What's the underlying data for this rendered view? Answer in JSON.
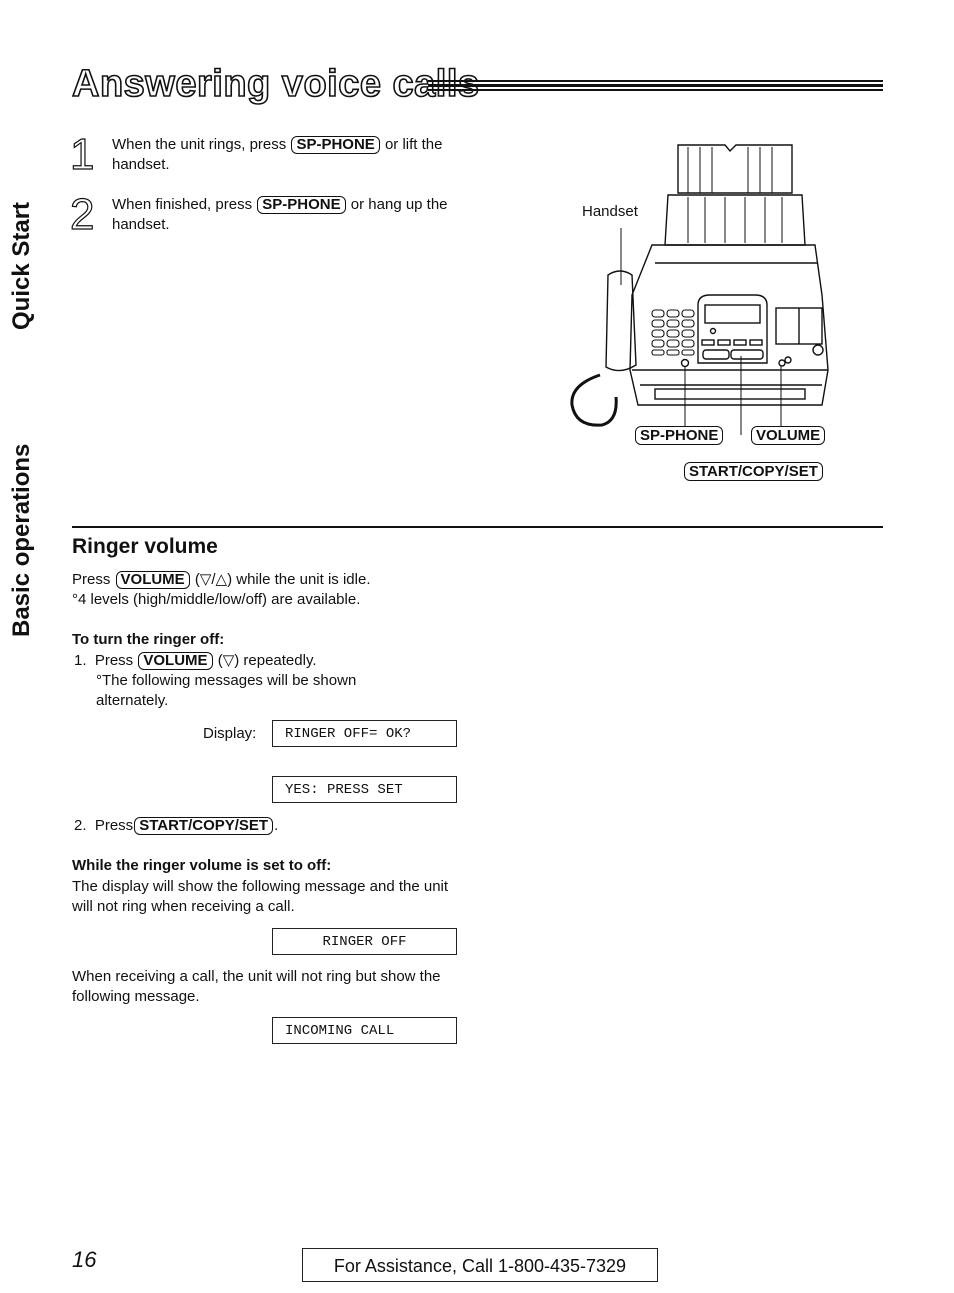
{
  "page": {
    "title": "Answering voice calls",
    "side_tabs": [
      "Quick Start",
      "Basic operations"
    ]
  },
  "steps": [
    {
      "number": "1",
      "pre": "When the unit rings, press",
      "key": "SP-PHONE",
      "post": "or lift the handset."
    },
    {
      "number": "2",
      "pre": "When finished, press",
      "key": "SP-PHONE",
      "post": "or hang up the handset."
    }
  ],
  "illustration": {
    "handset_label": "Handset",
    "callouts": [
      "SP-PHONE",
      "VOLUME",
      "START/COPY/SET"
    ]
  },
  "ringer": {
    "heading": "Ringer volume",
    "intro_pre": "Press",
    "intro_key": "VOLUME",
    "intro_post": "(▽/△) while the unit is idle.",
    "levels_note": "°4 levels (high/middle/low/off) are available.",
    "turn_off_heading": "To turn the ringer off:",
    "step1_pre": "1.  Press",
    "step1_key": "VOLUME",
    "step1_post": "(▽) repeatedly.",
    "step1_note": "°The following messages will be shown alternately.",
    "display_label": "Display:",
    "display_1": "RINGER OFF= OK?",
    "display_2": "YES: PRESS SET",
    "step2_pre": "2.  Press",
    "step2_key": "START/COPY/SET",
    "step2_post": ".",
    "while_off_heading": "While the ringer volume is set to off:",
    "while_off_text": "The display will show the following message and the unit will not ring when receiving a call.",
    "display_3": "RINGER OFF",
    "receiving_text": "When receiving a call, the unit will not ring but show the following message.",
    "display_4": "INCOMING CALL"
  },
  "footer": {
    "page_number": "16",
    "assistance": "For Assistance, Call 1-800-435-7329"
  }
}
